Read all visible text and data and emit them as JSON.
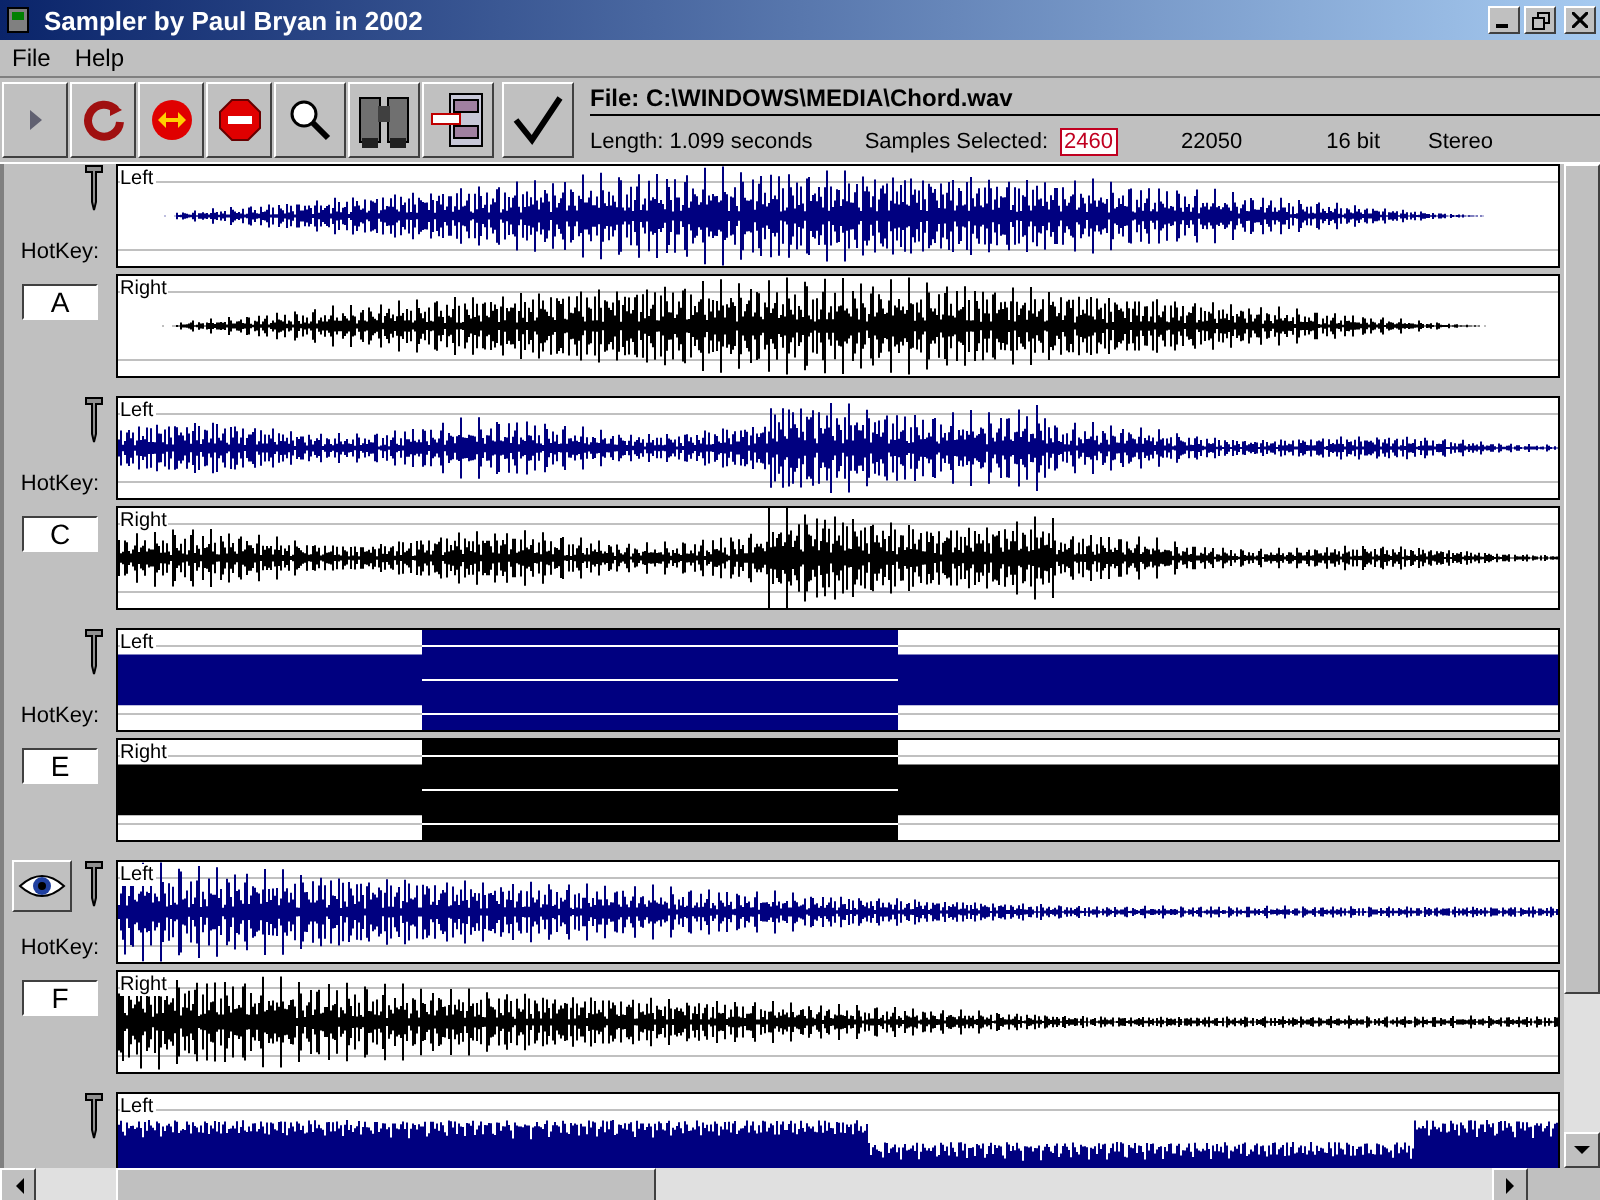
{
  "window": {
    "title": "Sampler by Paul Bryan in 2002"
  },
  "menu": [
    "File",
    "Help"
  ],
  "file_info": {
    "file": "File: C:\\WINDOWS\\MEDIA\\Chord.wav",
    "length": "Length: 1.099 seconds",
    "samples_label": "Samples Selected:",
    "samples_value": "2460",
    "rate": "22050",
    "bits": "16 bit",
    "channels": "Stereo"
  },
  "samples": [
    {
      "hotkey_label": "HotKey:",
      "hotkey": "A",
      "preview": false,
      "selected": false,
      "channels": [
        "Left",
        "Right"
      ]
    },
    {
      "hotkey_label": "HotKey:",
      "hotkey": "C",
      "preview": false,
      "selected": false,
      "channels": [
        "Left",
        "Right"
      ]
    },
    {
      "hotkey_label": "HotKey:",
      "hotkey": "E",
      "preview": false,
      "selected": true,
      "channels": [
        "Left",
        "Right"
      ]
    },
    {
      "hotkey_label": "HotKey:",
      "hotkey": "F",
      "preview": true,
      "selected": false,
      "channels": [
        "Left",
        "Right"
      ]
    },
    {
      "preview": false,
      "selected": false,
      "channels": [
        "Left"
      ]
    }
  ]
}
